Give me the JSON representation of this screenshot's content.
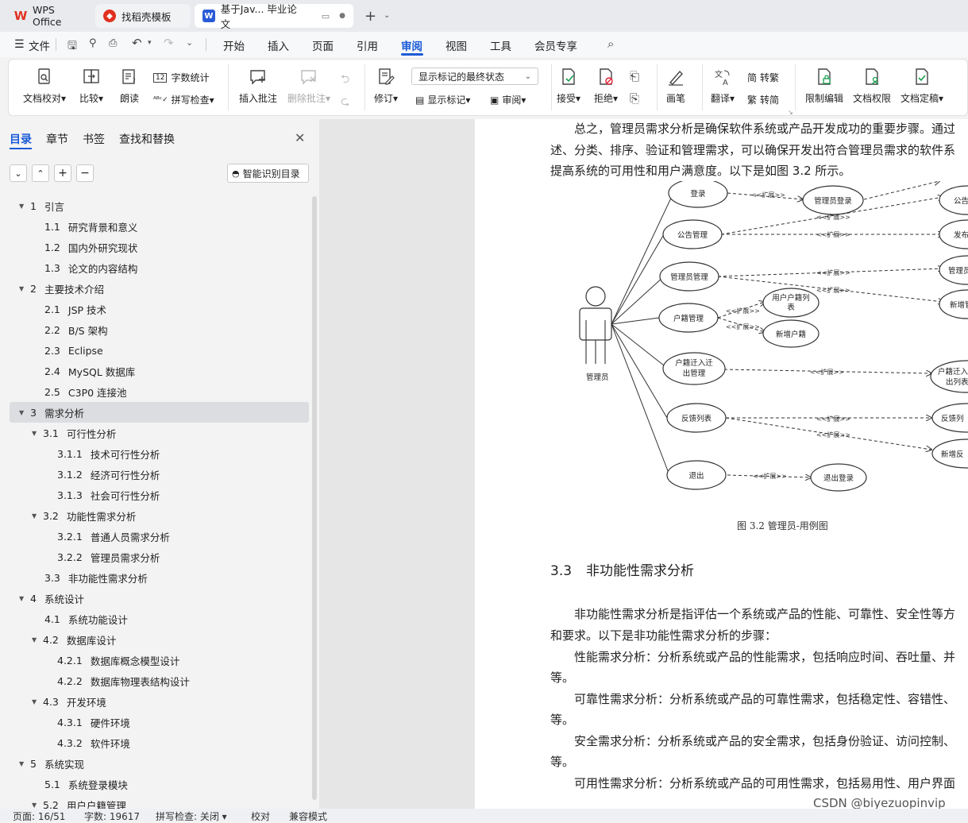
{
  "tabs": [
    {
      "label": "WPS Office",
      "icon": "wps-logo-icon"
    },
    {
      "label": "找稻壳模板",
      "icon": "docer-icon"
    },
    {
      "label": "基于Jav... 毕业论文",
      "icon": "word-doc-icon",
      "active": true
    }
  ],
  "menu": {
    "file": "文件",
    "items": [
      "开始",
      "插入",
      "页面",
      "引用",
      "审阅",
      "视图",
      "工具",
      "会员专享"
    ],
    "active": "审阅"
  },
  "ribbon": {
    "doc_check": "文档校对",
    "compare": "比较",
    "read_aloud": "朗读",
    "word_count": "字数统计",
    "spell_check": "拼写检查",
    "insert_comment": "插入批注",
    "delete_comment": "删除批注",
    "track": "修订",
    "markup_state": "显示标记的最终状态",
    "show_markup": "显示标记",
    "review": "审阅",
    "accept": "接受",
    "reject": "拒绝",
    "pen": "画笔",
    "translate": "翻译",
    "to_traditional": "转繁",
    "to_simplified": "转简",
    "restrict_edit": "限制编辑",
    "doc_permission": "文档权限",
    "doc_finalize": "文档定稿"
  },
  "nav": {
    "tabs": [
      "目录",
      "章节",
      "书签",
      "查找和替换"
    ],
    "smart_toc": "智能识别目录",
    "toc": [
      {
        "num": "1",
        "text": "引言",
        "level": 1,
        "arrow": true
      },
      {
        "num": "1.1",
        "text": "研究背景和意义",
        "level": 2
      },
      {
        "num": "1.2",
        "text": "国内外研究现状",
        "level": 2
      },
      {
        "num": "1.3",
        "text": "论文的内容结构",
        "level": 2
      },
      {
        "num": "2",
        "text": "主要技术介绍",
        "level": 1,
        "arrow": true
      },
      {
        "num": "2.1",
        "text": "JSP 技术",
        "level": 2
      },
      {
        "num": "2.2",
        "text": "B/S 架构",
        "level": 2
      },
      {
        "num": "2.3",
        "text": "Eclipse",
        "level": 2
      },
      {
        "num": "2.4",
        "text": "MySQL 数据库",
        "level": 2
      },
      {
        "num": "2.5",
        "text": "C3P0 连接池",
        "level": 2
      },
      {
        "num": "3",
        "text": "需求分析",
        "level": 1,
        "arrow": true,
        "selected": true
      },
      {
        "num": "3.1",
        "text": "可行性分析",
        "level": 2,
        "arrow": true
      },
      {
        "num": "3.1.1",
        "text": "技术可行性分析",
        "level": 3
      },
      {
        "num": "3.1.2",
        "text": "经济可行性分析",
        "level": 3
      },
      {
        "num": "3.1.3",
        "text": "社会可行性分析",
        "level": 3
      },
      {
        "num": "3.2",
        "text": "功能性需求分析",
        "level": 2,
        "arrow": true
      },
      {
        "num": "3.2.1",
        "text": "普通人员需求分析",
        "level": 3
      },
      {
        "num": "3.2.2",
        "text": "管理员需求分析",
        "level": 3
      },
      {
        "num": "3.3",
        "text": "非功能性需求分析",
        "level": 2
      },
      {
        "num": "4",
        "text": "系统设计",
        "level": 1,
        "arrow": true
      },
      {
        "num": "4.1",
        "text": "系统功能设计",
        "level": 2
      },
      {
        "num": "4.2",
        "text": "数据库设计",
        "level": 2,
        "arrow": true
      },
      {
        "num": "4.2.1",
        "text": "数据库概念模型设计",
        "level": 3
      },
      {
        "num": "4.2.2",
        "text": "数据库物理表结构设计",
        "level": 3
      },
      {
        "num": "4.3",
        "text": "开发环境",
        "level": 2,
        "arrow": true
      },
      {
        "num": "4.3.1",
        "text": "硬件环境",
        "level": 3
      },
      {
        "num": "4.3.2",
        "text": "软件环境",
        "level": 3
      },
      {
        "num": "5",
        "text": "系统实现",
        "level": 1,
        "arrow": true
      },
      {
        "num": "5.1",
        "text": "系统登录模块",
        "level": 2
      },
      {
        "num": "5.2",
        "text": "用户户籍管理",
        "level": 2,
        "arrow": true
      }
    ]
  },
  "doc": {
    "para1_l1": "总之，管理员需求分析是确保软件系统或产品开发成功的重要步骤。通过",
    "para1_l2": "述、分类、排序、验证和管理需求，可以确保开发出符合管理员需求的软件系",
    "para1_l3": "提高系统的可用性和用户满意度。以下是如图 3.2 所示。",
    "diagram": {
      "actor": "管理员",
      "extend": "<<扩展>>",
      "left_cases": [
        "登录",
        "公告管理",
        "管理员管理",
        "户籍管理",
        "户籍迁入迁出管理",
        "反馈列表",
        "退出"
      ],
      "left_cases_wrapped": [
        "户籍迁入迁",
        "出管理"
      ],
      "mid_cases": [
        "管理员登录",
        "用户户籍列表",
        "新增户籍",
        "退出登录"
      ],
      "mid_case_wrapped": [
        "用户户籍列",
        "表"
      ],
      "right_cases": [
        "公告",
        "发布",
        "管理员",
        "新增管",
        "户籍迁入",
        "出列表",
        "反馈列",
        "新增反"
      ]
    },
    "caption": "图 3.2   管理员-用例图",
    "heading_num": "3.3",
    "heading": "非功能性需求分析",
    "p2_l1": "非功能性需求分析是指评估一个系统或产品的性能、可靠性、安全性等方",
    "p2_l2": "和要求。以下是非功能性需求分析的步骤：",
    "p3_l1": "性能需求分析：分析系统或产品的性能需求，包括响应时间、吞吐量、并",
    "p3_l2": "等。",
    "p4_l1": "可靠性需求分析：分析系统或产品的可靠性需求，包括稳定性、容错性、",
    "p4_l2": "等。",
    "p5_l1": "安全需求分析：分析系统或产品的安全需求，包括身份验证、访问控制、",
    "p5_l2": "等。",
    "p6_l1": "可用性需求分析：分析系统或产品的可用性需求，包括易用性、用户界面"
  },
  "status": {
    "page": "页面: 16/51",
    "words": "字数: 19617",
    "spell": "拼写检查: 关闭",
    "proof": "校对",
    "compat": "兼容模式",
    "watermark": "CSDN @biyezuopinvip"
  }
}
